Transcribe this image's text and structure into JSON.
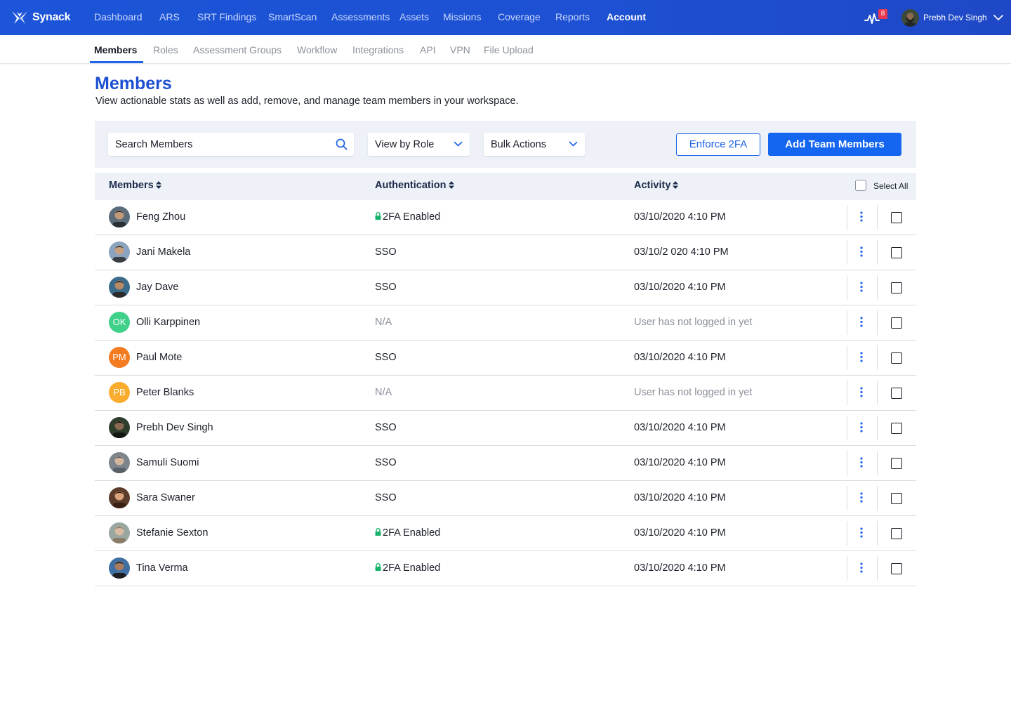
{
  "app": {
    "brand": "Synack",
    "nav": [
      "Dashboard",
      "ARS",
      "SRT Findings",
      "SmartScan",
      "Assessments",
      "Assets",
      "Missions",
      "Coverage",
      "Reports",
      "Account"
    ],
    "active_nav": "Account",
    "notification_count": "8",
    "user_name": "Prebh Dev Singh",
    "accent_color": "#1d50d2"
  },
  "subnav": {
    "items": [
      "Members",
      "Roles",
      "Assessment Groups",
      "Workflow",
      "Integrations",
      "API",
      "VPN",
      "File Upload"
    ],
    "active": "Members"
  },
  "page": {
    "title": "Members",
    "subtitle": "View actionable stats as well as add, remove, and manage team members in your workspace."
  },
  "toolbar": {
    "search_placeholder": "Search Members",
    "view_role_label": "View by Role",
    "bulk_actions_label": "Bulk Actions",
    "enforce_label": "Enforce 2FA",
    "add_label": "Add Team Members"
  },
  "table": {
    "columns": {
      "members": "Members",
      "authentication": "Authentication",
      "activity": "Activity",
      "select_all": "Select All"
    },
    "rows": [
      {
        "name": "Feng Zhou",
        "auth": "2FA Enabled",
        "activity": "03/10/2020 4:10 PM",
        "avatar": "photo"
      },
      {
        "name": "Jani Makela",
        "auth": "SSO",
        "activity": "03/10/2  020 4:10 PM",
        "avatar": "photo"
      },
      {
        "name": "Jay Dave",
        "auth": "SSO",
        "activity": "03/10/2020 4:10 PM",
        "avatar": "photo"
      },
      {
        "name": "Olli Karppinen",
        "auth": "N/A",
        "activity": "User has not logged in yet",
        "avatar": "initials",
        "initials": "OK",
        "color": "#3fd08a"
      },
      {
        "name": "Paul Mote",
        "auth": "SSO",
        "activity": "03/10/2020 4:10 PM",
        "avatar": "initials",
        "initials": "PM",
        "color": "#f47b20"
      },
      {
        "name": "Peter Blanks",
        "auth": "N/A",
        "activity": "User has not logged in yet",
        "avatar": "initials",
        "initials": "PB",
        "color": "#f9ac2e"
      },
      {
        "name": "Prebh Dev Singh",
        "auth": "SSO",
        "activity": "03/10/2020 4:10 PM",
        "avatar": "photo"
      },
      {
        "name": "Samuli Suomi",
        "auth": "SSO",
        "activity": "03/10/2020 4:10 PM",
        "avatar": "photo"
      },
      {
        "name": "Sara Swaner",
        "auth": "SSO",
        "activity": "03/10/2020 4:10 PM",
        "avatar": "photo"
      },
      {
        "name": "Stefanie Sexton",
        "auth": "2FA Enabled",
        "activity": "03/10/2020 4:10 PM",
        "avatar": "photo"
      },
      {
        "name": "Tina Verma",
        "auth": "2FA Enabled",
        "activity": "03/10/2020 4:10 PM",
        "avatar": "photo"
      }
    ]
  }
}
